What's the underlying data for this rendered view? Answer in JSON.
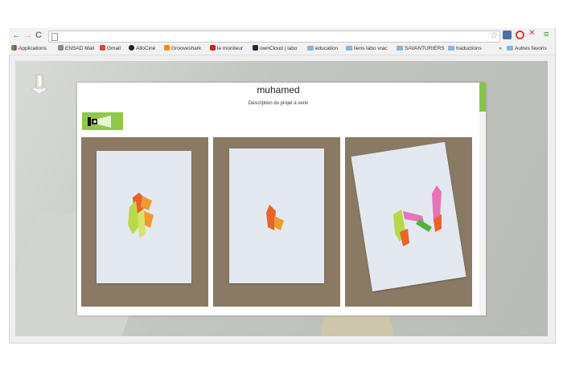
{
  "browser": {
    "bookmarks": [
      {
        "label": "Applications",
        "icon": "apps-grid-icon"
      },
      {
        "label": "ENSAD Mail",
        "icon": "mail-icon"
      },
      {
        "label": "Gmail",
        "icon": "gmail-icon"
      },
      {
        "label": "AlloCiné",
        "icon": "allocine-icon"
      },
      {
        "label": "Grooveshark",
        "icon": "grooveshark-icon"
      },
      {
        "label": "le moniteur",
        "icon": "moniteur-icon"
      },
      {
        "label": "ownCloud | labo",
        "icon": "owncloud-icon"
      },
      {
        "label": "éducation",
        "icon": "folder-icon"
      },
      {
        "label": "liens labo vrac",
        "icon": "folder-icon"
      },
      {
        "label": "SAVANTURIERS",
        "icon": "folder-icon"
      },
      {
        "label": "traductions",
        "icon": "folder-icon"
      }
    ],
    "overflow_label": "»",
    "other_bookmarks": "Autres favoris",
    "nav": {
      "back": "←",
      "forward": "→",
      "reload": "C"
    }
  },
  "project": {
    "title": "muhamed",
    "description": "Description du projet à venir"
  },
  "colors": {
    "accent": "#8fc84a",
    "background": "#c9ccc6"
  }
}
